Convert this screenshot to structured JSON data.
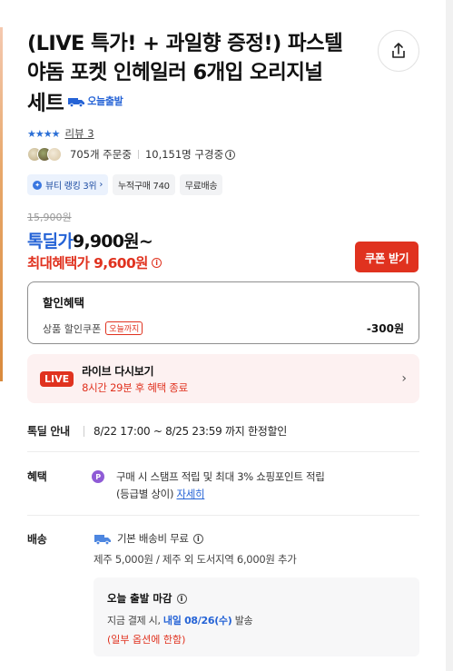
{
  "product": {
    "title": "(LIVE 특가! + 과일향 증정!) 파스텔 야돔 포켓 인헤일러 6개입 오리지널 세트",
    "today_badge": "오늘출발"
  },
  "rating": {
    "stars": 4,
    "review_label": "리뷰 3"
  },
  "social": {
    "orders": "705개 주문중",
    "subscribers": "10,151명 구경중"
  },
  "chips": {
    "rank": "뷰티 랭킹 3위",
    "cumulative": "누적구매 740",
    "shipping": "무료배송"
  },
  "price": {
    "original": "15,900원",
    "sale_label": "톡딜가",
    "sale_price": "9,900원~",
    "max_label": "최대혜택가",
    "max_price": "9,600원",
    "coupon_button": "쿠폰 받기"
  },
  "discount": {
    "title": "할인혜택",
    "item": "상품 할인쿠폰",
    "tag": "오늘까지",
    "amount": "-300원"
  },
  "live": {
    "badge": "LIVE",
    "title": "라이브 다시보기",
    "subtitle": "8시간 29분 후 혜택 종료"
  },
  "deal": {
    "label": "톡딜 안내",
    "period": "8/22 17:00 ~ 8/25 23:59 까지 한정할인"
  },
  "benefit": {
    "label": "혜택",
    "line1": "구매 시 스탬프 적립 및 최대 3% 쇼핑포인트 적립",
    "line2": "(등급별 상이)",
    "link": "자세히"
  },
  "shipping": {
    "label": "배송",
    "basic": "기본 배송비 무료",
    "extra": "제주 5,000원 / 제주 외 도서지역 6,000원 추가",
    "deadline_title": "오늘 출발 마감",
    "deadline_prefix": "지금 결제 시,",
    "deadline_date": "내일 08/26(수)",
    "deadline_suffix": "발송",
    "deadline_note": "(일부 옵션에 한함)"
  },
  "colors": {
    "accent_blue": "#2563d6",
    "accent_red": "#e0321f"
  }
}
